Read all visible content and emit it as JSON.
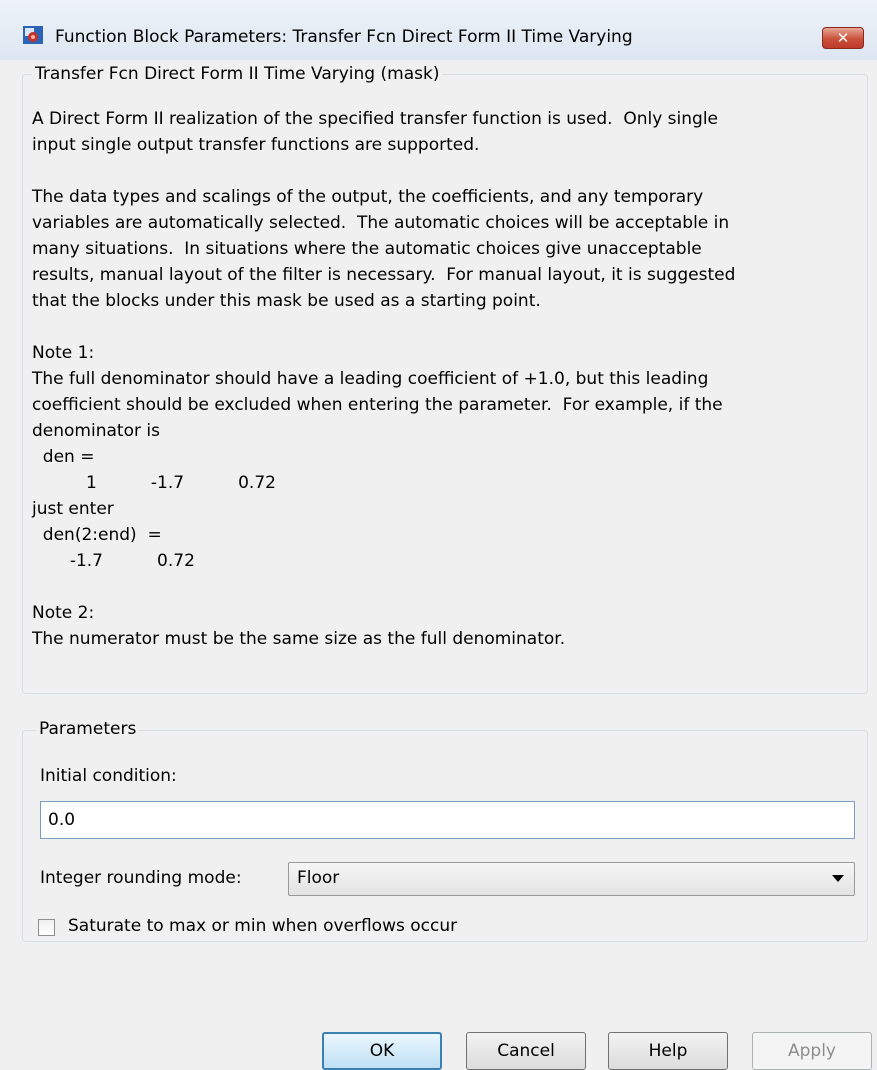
{
  "window": {
    "title": "Function Block Parameters: Transfer Fcn Direct Form II Time Varying",
    "close_label": "✕"
  },
  "mask_group": {
    "legend": "Transfer Fcn Direct Form II Time Varying (mask)",
    "description_lines": [
      "A Direct Form II realization of the specified transfer function is used.  Only single",
      "input single output transfer functions are supported.",
      "",
      "The data types and scalings of the output, the coefficients, and any temporary",
      "variables are automatically selected.  The automatic choices will be acceptable in",
      "many situations.  In situations where the automatic choices give unacceptable",
      "results, manual layout of the filter is necessary.  For manual layout, it is suggested",
      "that the blocks under this mask be used as a starting point.",
      "",
      "Note 1:",
      "The full denominator should have a leading coefficient of +1.0, but this leading",
      "coefficient should be excluded when entering the parameter.  For example, if the",
      "denominator is",
      "  den =",
      "          1          -1.7          0.72",
      "just enter",
      "  den(2:end)  =",
      "       -1.7          0.72",
      "",
      "Note 2:",
      "The numerator must be the same size as the full denominator."
    ]
  },
  "parameters": {
    "legend": "Parameters",
    "initial_condition_label": "Initial condition:",
    "initial_condition_value": "0.0",
    "rounding_label": "Integer rounding mode:",
    "rounding_value": "Floor",
    "saturate_label": "Saturate to max or min when overflows occur",
    "saturate_checked": false
  },
  "buttons": {
    "ok": "OK",
    "cancel": "Cancel",
    "help": "Help",
    "apply": "Apply"
  },
  "colors": {
    "close_button": "#c9513a",
    "field_border": "#7a9cc4"
  }
}
